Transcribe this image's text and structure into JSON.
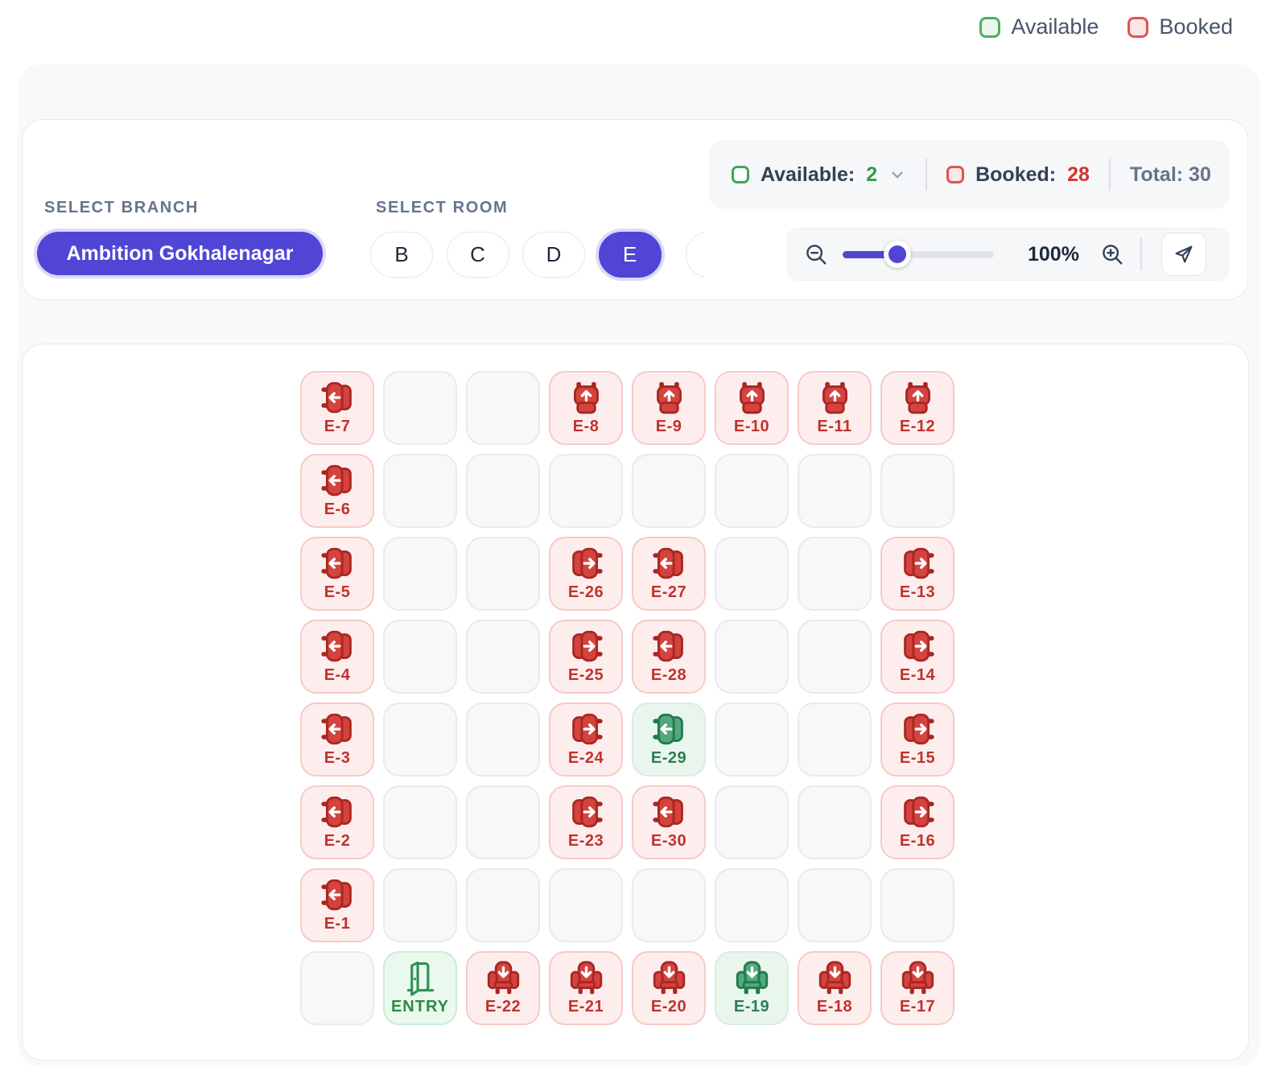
{
  "legend": {
    "available": "Available",
    "booked": "Booked"
  },
  "toolbar": {
    "branch_label": "SELECT BRANCH",
    "branch_value": "Ambition Gokhalenagar",
    "room_label": "SELECT ROOM",
    "rooms": [
      {
        "label": "B",
        "selected": false
      },
      {
        "label": "C",
        "selected": false
      },
      {
        "label": "D",
        "selected": false
      },
      {
        "label": "E",
        "selected": true
      }
    ],
    "stats": {
      "available_label": "Available:",
      "available_value": "2",
      "booked_label": "Booked:",
      "booked_value": "28",
      "total_label": "Total:",
      "total_value": "30"
    },
    "zoom": {
      "level": "100%",
      "slider_percent": 36
    }
  },
  "colors": {
    "accent_indigo": "#5145d6",
    "booked_fill": "#d5433e",
    "booked_stroke": "#a82723",
    "available_fill": "#53a87c",
    "available_stroke": "#1f7a4d",
    "entry_green": "#2f9150",
    "available_green": "#2f9e44",
    "booked_red": "#d23430"
  },
  "seat_map": {
    "entry_label": "ENTRY",
    "rows": [
      [
        {
          "t": "seat",
          "label": "E-7",
          "status": "booked",
          "dir": "left"
        },
        {
          "t": "empty"
        },
        {
          "t": "empty"
        },
        {
          "t": "seat",
          "label": "E-8",
          "status": "booked",
          "dir": "up"
        },
        {
          "t": "seat",
          "label": "E-9",
          "status": "booked",
          "dir": "up"
        },
        {
          "t": "seat",
          "label": "E-10",
          "status": "booked",
          "dir": "up"
        },
        {
          "t": "seat",
          "label": "E-11",
          "status": "booked",
          "dir": "up"
        },
        {
          "t": "seat",
          "label": "E-12",
          "status": "booked",
          "dir": "up"
        }
      ],
      [
        {
          "t": "seat",
          "label": "E-6",
          "status": "booked",
          "dir": "left"
        },
        {
          "t": "empty"
        },
        {
          "t": "empty"
        },
        {
          "t": "empty"
        },
        {
          "t": "empty"
        },
        {
          "t": "empty"
        },
        {
          "t": "empty"
        },
        {
          "t": "empty"
        }
      ],
      [
        {
          "t": "seat",
          "label": "E-5",
          "status": "booked",
          "dir": "left"
        },
        {
          "t": "empty"
        },
        {
          "t": "empty"
        },
        {
          "t": "seat",
          "label": "E-26",
          "status": "booked",
          "dir": "right"
        },
        {
          "t": "seat",
          "label": "E-27",
          "status": "booked",
          "dir": "left"
        },
        {
          "t": "empty"
        },
        {
          "t": "empty"
        },
        {
          "t": "seat",
          "label": "E-13",
          "status": "booked",
          "dir": "right"
        }
      ],
      [
        {
          "t": "seat",
          "label": "E-4",
          "status": "booked",
          "dir": "left"
        },
        {
          "t": "empty"
        },
        {
          "t": "empty"
        },
        {
          "t": "seat",
          "label": "E-25",
          "status": "booked",
          "dir": "right"
        },
        {
          "t": "seat",
          "label": "E-28",
          "status": "booked",
          "dir": "left"
        },
        {
          "t": "empty"
        },
        {
          "t": "empty"
        },
        {
          "t": "seat",
          "label": "E-14",
          "status": "booked",
          "dir": "right"
        }
      ],
      [
        {
          "t": "seat",
          "label": "E-3",
          "status": "booked",
          "dir": "left"
        },
        {
          "t": "empty"
        },
        {
          "t": "empty"
        },
        {
          "t": "seat",
          "label": "E-24",
          "status": "booked",
          "dir": "right"
        },
        {
          "t": "seat",
          "label": "E-29",
          "status": "available",
          "dir": "left"
        },
        {
          "t": "empty"
        },
        {
          "t": "empty"
        },
        {
          "t": "seat",
          "label": "E-15",
          "status": "booked",
          "dir": "right"
        }
      ],
      [
        {
          "t": "seat",
          "label": "E-2",
          "status": "booked",
          "dir": "left"
        },
        {
          "t": "empty"
        },
        {
          "t": "empty"
        },
        {
          "t": "seat",
          "label": "E-23",
          "status": "booked",
          "dir": "right"
        },
        {
          "t": "seat",
          "label": "E-30",
          "status": "booked",
          "dir": "left"
        },
        {
          "t": "empty"
        },
        {
          "t": "empty"
        },
        {
          "t": "seat",
          "label": "E-16",
          "status": "booked",
          "dir": "right"
        }
      ],
      [
        {
          "t": "seat",
          "label": "E-1",
          "status": "booked",
          "dir": "left"
        },
        {
          "t": "empty"
        },
        {
          "t": "empty"
        },
        {
          "t": "empty"
        },
        {
          "t": "empty"
        },
        {
          "t": "empty"
        },
        {
          "t": "empty"
        },
        {
          "t": "empty"
        }
      ],
      [
        {
          "t": "empty"
        },
        {
          "t": "entry"
        },
        {
          "t": "seat",
          "label": "E-22",
          "status": "booked",
          "dir": "down"
        },
        {
          "t": "seat",
          "label": "E-21",
          "status": "booked",
          "dir": "down"
        },
        {
          "t": "seat",
          "label": "E-20",
          "status": "booked",
          "dir": "down"
        },
        {
          "t": "seat",
          "label": "E-19",
          "status": "available",
          "dir": "down"
        },
        {
          "t": "seat",
          "label": "E-18",
          "status": "booked",
          "dir": "down"
        },
        {
          "t": "seat",
          "label": "E-17",
          "status": "booked",
          "dir": "down"
        }
      ]
    ]
  }
}
